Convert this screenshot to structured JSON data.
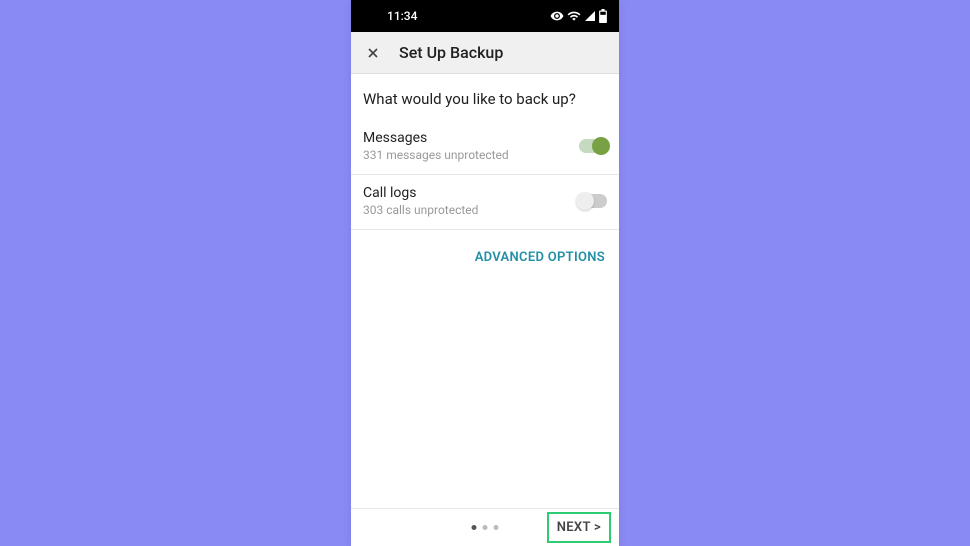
{
  "statusbar": {
    "time": "11:34"
  },
  "appbar": {
    "title": "Set Up Backup"
  },
  "content": {
    "heading": "What would you like to back up?",
    "options": [
      {
        "label": "Messages",
        "sub": "331 messages unprotected",
        "enabled": true
      },
      {
        "label": "Call logs",
        "sub": "303 calls unprotected",
        "enabled": false
      }
    ],
    "advanced_label": "ADVANCED OPTIONS"
  },
  "footer": {
    "next_label": "NEXT >"
  }
}
